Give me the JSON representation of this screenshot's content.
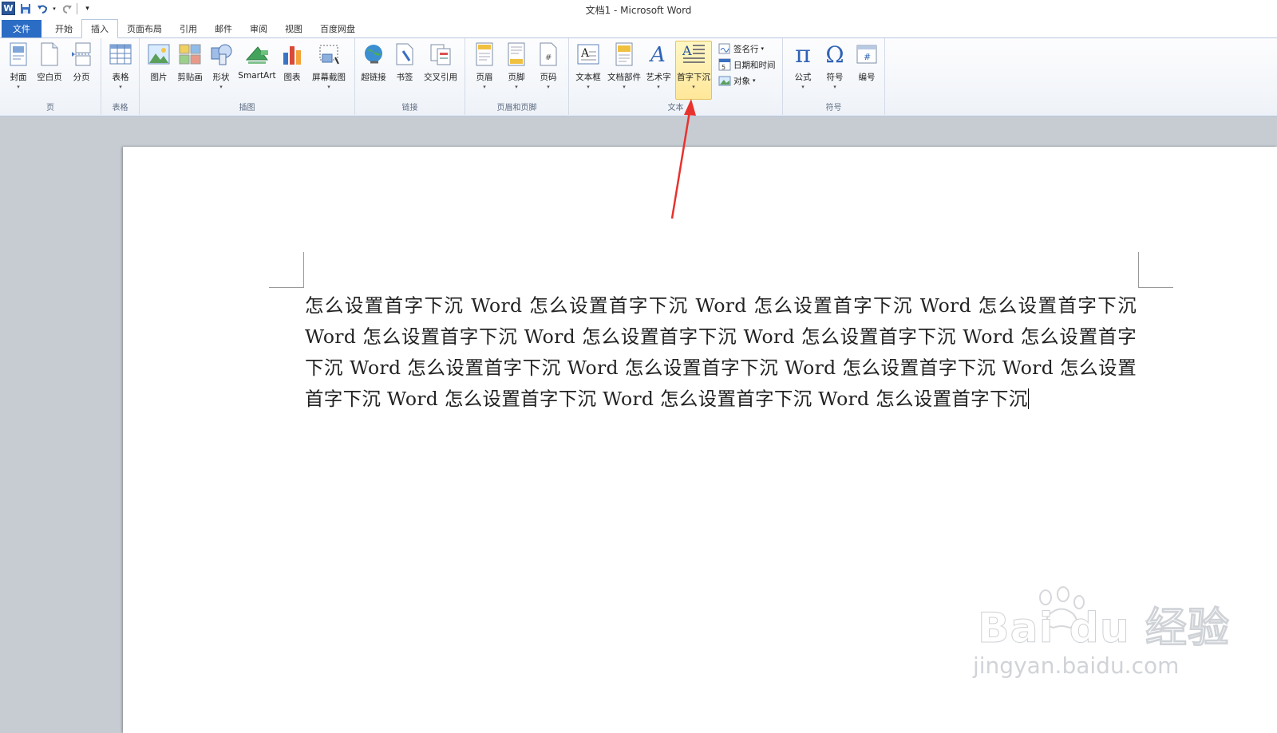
{
  "window": {
    "title": "文档1 - Microsoft Word"
  },
  "qat": {
    "logo": "W"
  },
  "tabs": [
    {
      "label": "文件"
    },
    {
      "label": "开始"
    },
    {
      "label": "插入"
    },
    {
      "label": "页面布局"
    },
    {
      "label": "引用"
    },
    {
      "label": "邮件"
    },
    {
      "label": "审阅"
    },
    {
      "label": "视图"
    },
    {
      "label": "百度网盘"
    }
  ],
  "ribbon": {
    "groups": {
      "page": "页",
      "table": "表格",
      "illustrations": "插图",
      "links": "链接",
      "header_footer": "页眉和页脚",
      "text": "文本",
      "symbols": "符号"
    },
    "buttons": {
      "cover": "封面",
      "blank_page": "空白页",
      "page_break": "分页",
      "table": "表格",
      "picture": "图片",
      "clipart": "剪贴画",
      "shapes": "形状",
      "smartart": "SmartArt",
      "chart": "图表",
      "screenshot": "屏幕截图",
      "hyperlink": "超链接",
      "bookmark": "书签",
      "cross_ref": "交叉引用",
      "header": "页眉",
      "footer": "页脚",
      "page_number": "页码",
      "textbox": "文本框",
      "quick_parts": "文档部件",
      "wordart": "艺术字",
      "dropcap": "首字下沉",
      "signature_line": "签名行",
      "date_time": "日期和时间",
      "object": "对象",
      "equation": "公式",
      "symbol": "符号",
      "number": "编号"
    }
  },
  "document": {
    "text": "怎么设置首字下沉 Word 怎么设置首字下沉 Word 怎么设置首字下沉 Word 怎么设置首字下沉 Word 怎么设置首字下沉 Word 怎么设置首字下沉 Word 怎么设置首字下沉 Word 怎么设置首字下沉 Word 怎么设置首字下沉 Word 怎么设置首字下沉 Word 怎么设置首字下沉 Word 怎么设置首字下沉 Word 怎么设置首字下沉 Word 怎么设置首字下沉 Word 怎么设置首字下沉"
  },
  "watermark": {
    "main": "Bai du 经验",
    "sub": "jingyan.baidu.com"
  },
  "colors": {
    "file_tab": "#2b6cc4",
    "highlight": "#ffe79a",
    "arrow": "#e8322e",
    "doc_bg": "#c7ccd3"
  }
}
